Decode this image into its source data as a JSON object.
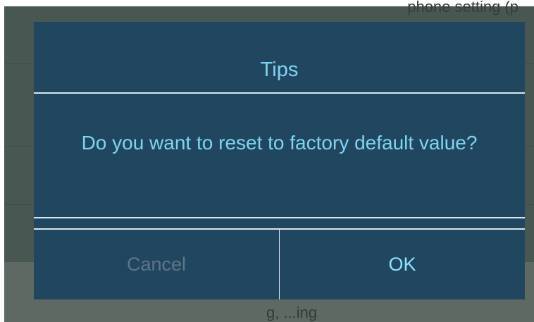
{
  "background": {
    "top_text": "phone setting (p",
    "bottom_text": "g, ...ing"
  },
  "dialog": {
    "title": "Tips",
    "message": "Do you want to reset to factory default value?",
    "cancel_label": "Cancel",
    "ok_label": "OK"
  },
  "colors": {
    "dialog_bg": "#214760",
    "text": "#7fd3f2",
    "cancel_disabled": "#5e7686",
    "divider": "#d9e6ec",
    "backdrop": "#495753"
  }
}
